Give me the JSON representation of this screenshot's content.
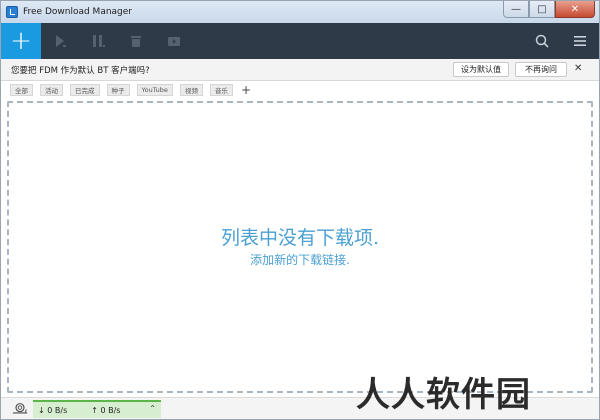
{
  "window": {
    "title": "Free Download Manager"
  },
  "window_controls": {
    "minimize": "—",
    "maximize": "□",
    "close": "✕"
  },
  "toolbar": {
    "add_label": "+",
    "icons": [
      "play-icon",
      "pause-icon",
      "delete-icon",
      "move-icon",
      "search-icon",
      "menu-icon"
    ]
  },
  "notice": {
    "text": "您要把 FDM 作为默认 BT 客户端吗?",
    "set_default": "设为默认值",
    "dont_ask": "不再询问",
    "close": "✕"
  },
  "tags": [
    "全部",
    "活动",
    "已完成",
    "种子",
    "YouTube",
    "视频",
    "音乐"
  ],
  "tag_add": "+",
  "main": {
    "empty_title": "列表中没有下载项.",
    "empty_subtitle": "添加新的下载链接."
  },
  "status": {
    "download_speed": "↓ 0 B/s",
    "upload_speed": "↑ 0 B/s",
    "expand": "⌃"
  },
  "watermark": "人人软件园",
  "colors": {
    "accent": "#1a9ae0",
    "toolbar_bg": "#2e3a48",
    "empty_text": "#4a9fd3",
    "speed_panel": "#d7efd0"
  }
}
